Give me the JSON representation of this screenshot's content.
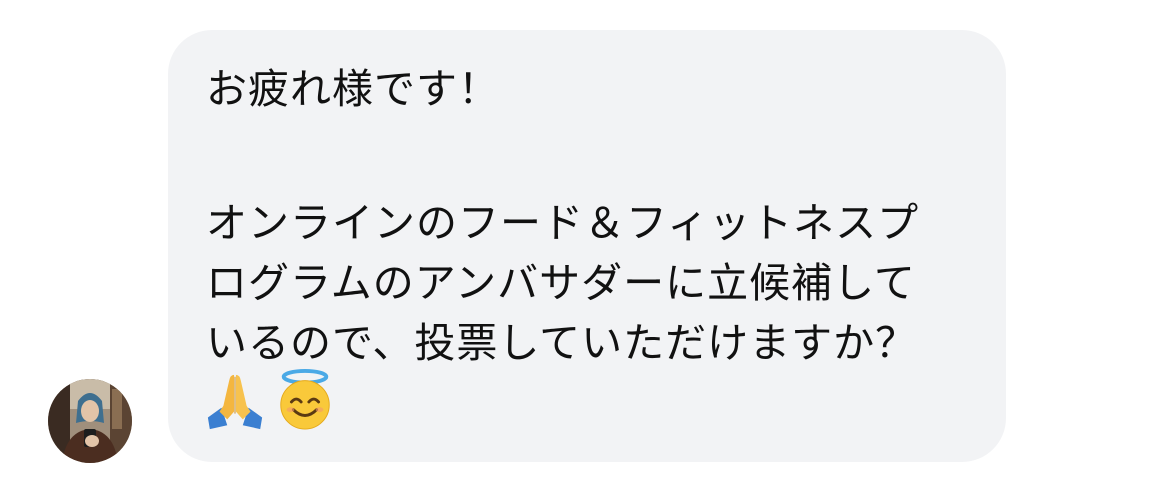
{
  "message": {
    "lines": [
      "お疲れ様です！",
      "オンラインのフード＆フィットネスプ",
      "ログラムのアンバサダーに立候補して",
      "いるので、投票していただけますか？"
    ],
    "emojis": [
      "folded-hands-emoji",
      "smiling-face-with-halo-emoji"
    ]
  },
  "sender": {
    "avatar": "avatar-photo"
  },
  "colors": {
    "bubble_bg": "#f2f3f5",
    "text": "#111111",
    "page_bg": "#ffffff"
  }
}
